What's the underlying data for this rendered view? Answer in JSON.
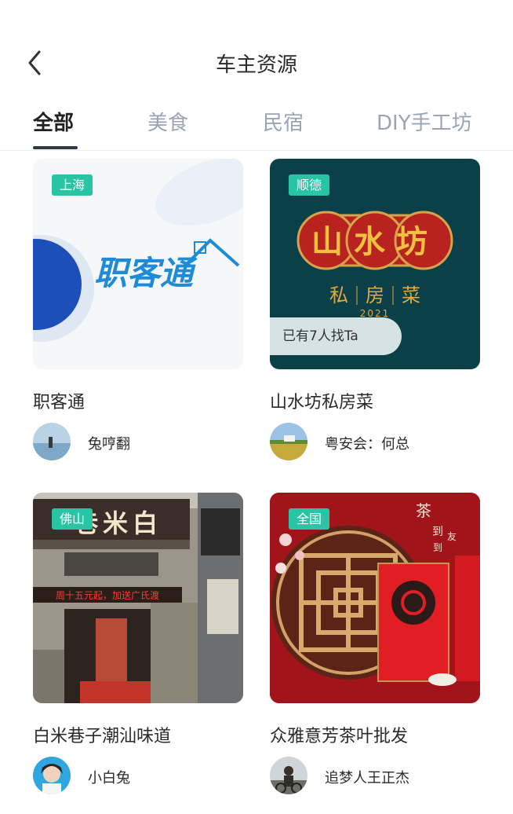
{
  "header": {
    "title": "车主资源"
  },
  "tabs": [
    {
      "label": "全部"
    },
    {
      "label": "美食"
    },
    {
      "label": "民宿"
    },
    {
      "label": "DIY手工坊"
    }
  ],
  "cards": [
    {
      "tag": "上海",
      "name": "职客通",
      "owner": "兔哼翻",
      "logo_text": "职客通"
    },
    {
      "tag": "顺德",
      "name": "山水坊私房菜",
      "owner": "粤安会：何总",
      "found_text": "已有7人找Ta",
      "logo_main": "山水坊",
      "logo_sub": [
        "私",
        "房",
        "菜"
      ],
      "logo_year": "2021"
    },
    {
      "tag": "佛山",
      "name": "白米巷子潮汕味道",
      "owner": "小白兔",
      "sign_text": "巷米白",
      "banner_text": "周十五元起，加送广氏渡"
    },
    {
      "tag": "全国",
      "name": "众雅意芳茶叶批发",
      "owner": "追梦人王正杰",
      "poster_text": [
        "茶",
        "到",
        "友",
        "到"
      ]
    }
  ],
  "colors": {
    "accent_tag": "#28c4a4",
    "tab_inactive": "#9aa5b4",
    "tab_active": "#222222"
  }
}
